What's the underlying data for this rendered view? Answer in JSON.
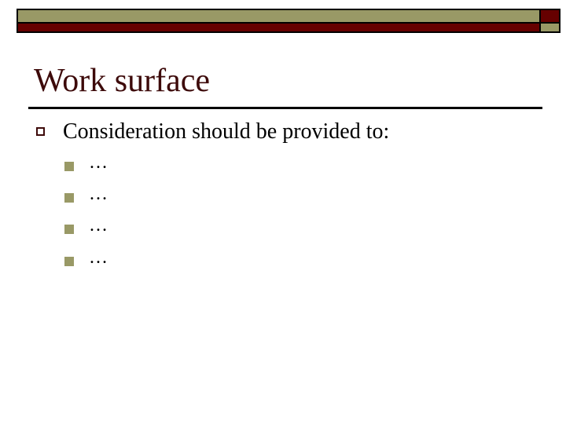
{
  "slide": {
    "title": "Work surface",
    "colors": {
      "accent_olive": "#999966",
      "accent_red": "#660000",
      "title": "#3d0a0a"
    },
    "bullets": [
      {
        "icon": "hollow-square-bullet",
        "text": "Consideration should be provided to:",
        "sub_bullets": [
          {
            "icon": "filled-square-bullet",
            "text": "…"
          },
          {
            "icon": "filled-square-bullet",
            "text": "…"
          },
          {
            "icon": "filled-square-bullet",
            "text": "…"
          },
          {
            "icon": "filled-square-bullet",
            "text": "…"
          }
        ]
      }
    ]
  }
}
